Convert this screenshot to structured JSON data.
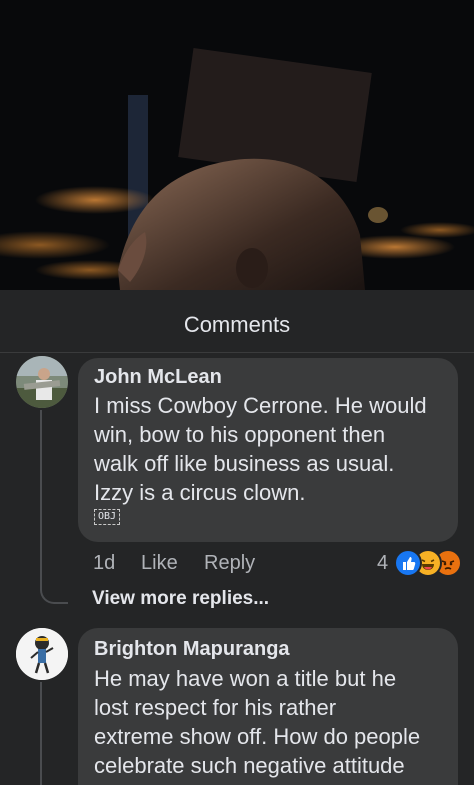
{
  "sheet": {
    "title": "Comments"
  },
  "comments": [
    {
      "author": "John McLean",
      "text": "I miss Cowboy Cerrone. He would\nwin, bow to his opponent then\nwalk off like business as usual.\nIzzy is a circus clown.",
      "obj_marker": "OBJ",
      "time": "1d",
      "like_label": "Like",
      "reply_label": "Reply",
      "reaction_count": "4",
      "reactions": [
        "like-icon",
        "haha-icon",
        "angry-icon"
      ],
      "more_replies": "View more replies..."
    },
    {
      "author": "Brighton Mapuranga",
      "text": "He may have won a title but he\nlost respect for his rather\nextreme show off. How do people\ncelebrate such negative attitude"
    }
  ],
  "colors": {
    "background": "#242526",
    "bubble": "#3a3b3c",
    "like_blue": "#1877f2",
    "haha_yellow": "#f7b125",
    "angry_red": "#e9710f"
  }
}
